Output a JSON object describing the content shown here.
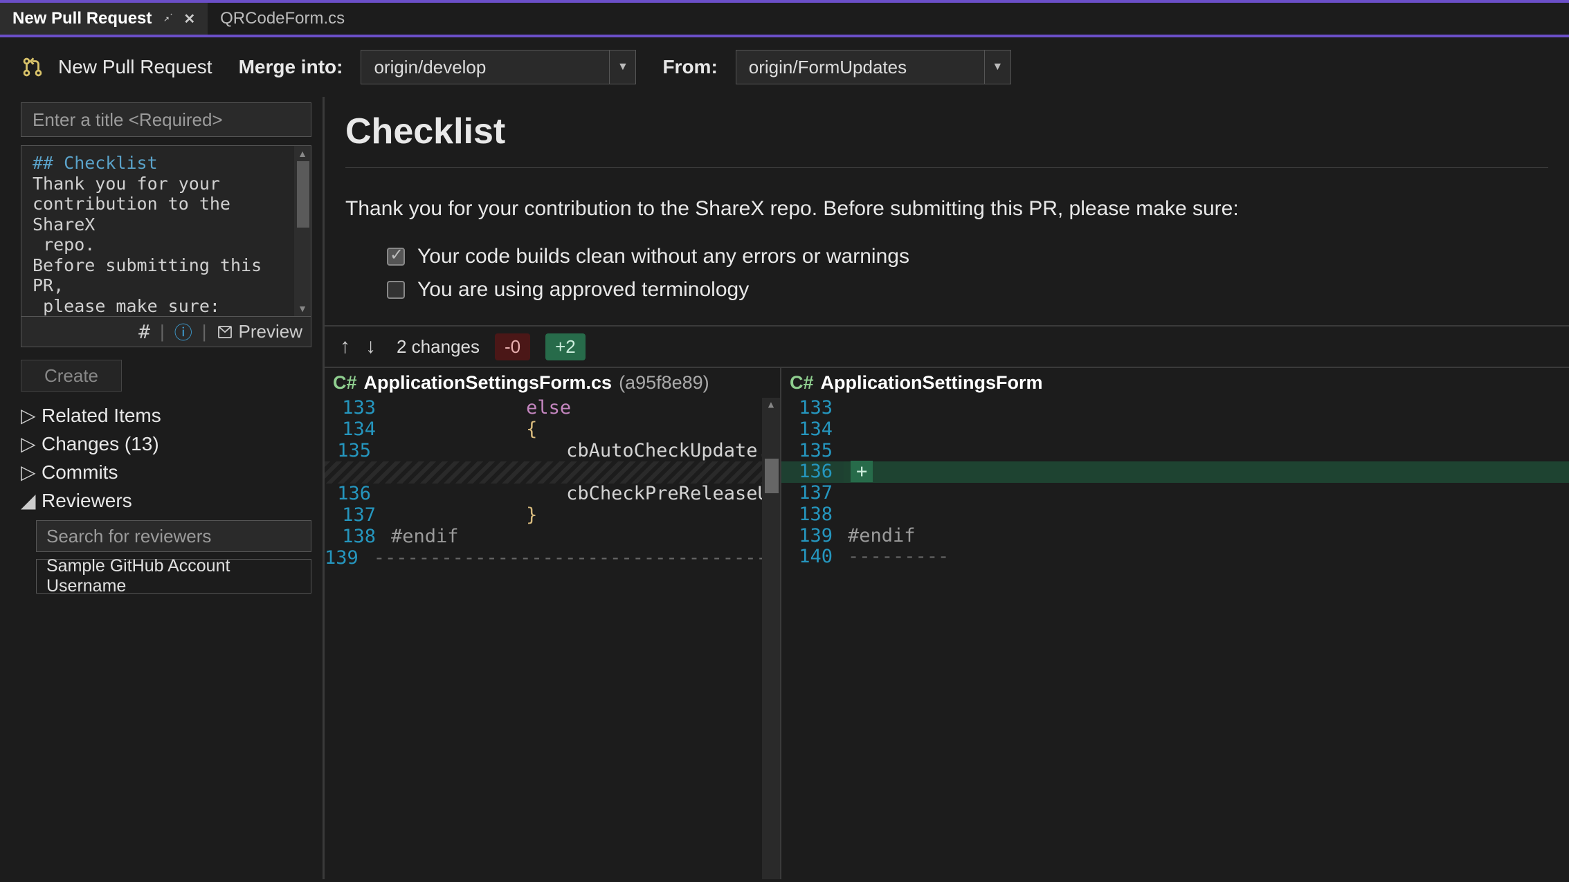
{
  "tabs": {
    "active": {
      "label": "New Pull Request"
    },
    "inactive": {
      "label": "QRCodeForm.cs"
    }
  },
  "toolbar": {
    "title": "New Pull Request",
    "merge_label": "Merge into:",
    "merge_value": "origin/develop",
    "from_label": "From:",
    "from_value": "origin/FormUpdates"
  },
  "pr_form": {
    "title_placeholder": "Enter a title <Required>",
    "description_raw": "## Checklist\nThank you for your contribution to the ShareX repo.\nBefore submitting this PR, please make sure:\n\n- [x] Your code builds",
    "preview_label": "Preview",
    "create_label": "Create"
  },
  "sidebar_tree": {
    "related_items": "Related Items",
    "changes": "Changes (13)",
    "commits": "Commits",
    "reviewers": "Reviewers",
    "reviewers_search_placeholder": "Search for reviewers",
    "reviewer_sample": "Sample GitHub Account Username"
  },
  "preview": {
    "heading": "Checklist",
    "para": "Thank you for your contribution to the ShareX repo. Before submitting this PR, please make sure:",
    "check1": "Your code builds clean without any errors or warnings",
    "check2": "You are using approved terminology"
  },
  "diff": {
    "changes_label": "2 changes",
    "minus_badge": "-0",
    "plus_badge": "+2",
    "left": {
      "lang": "C#",
      "file": "ApplicationSettingsForm.cs",
      "hash": "(a95f8e89)",
      "lines": [
        {
          "num": "133",
          "text": "            else",
          "cls": "kw"
        },
        {
          "num": "134",
          "text": "            {",
          "cls": "br"
        },
        {
          "num": "135",
          "text": "                cbAutoCheckUpdate.C",
          "cls": ""
        },
        {
          "num": "",
          "text": "",
          "cls": "hatched"
        },
        {
          "num": "136",
          "text": "                cbCheckPreReleaseUp",
          "cls": ""
        },
        {
          "num": "137",
          "text": "            }",
          "cls": "br"
        },
        {
          "num": "138",
          "text": "#endif",
          "cls": "pp"
        },
        {
          "num": "139",
          "text": "----------------------------------------",
          "cls": "dash"
        }
      ]
    },
    "right": {
      "lang": "C#",
      "file": "ApplicationSettingsForm",
      "lines": [
        {
          "num": "133",
          "text": ""
        },
        {
          "num": "134",
          "text": ""
        },
        {
          "num": "135",
          "text": ""
        },
        {
          "num": "136",
          "text": "",
          "added": true
        },
        {
          "num": "137",
          "text": ""
        },
        {
          "num": "138",
          "text": ""
        },
        {
          "num": "139",
          "text": "#endif",
          "cls": "pp"
        },
        {
          "num": "140",
          "text": "---------",
          "cls": "dash"
        }
      ]
    }
  }
}
